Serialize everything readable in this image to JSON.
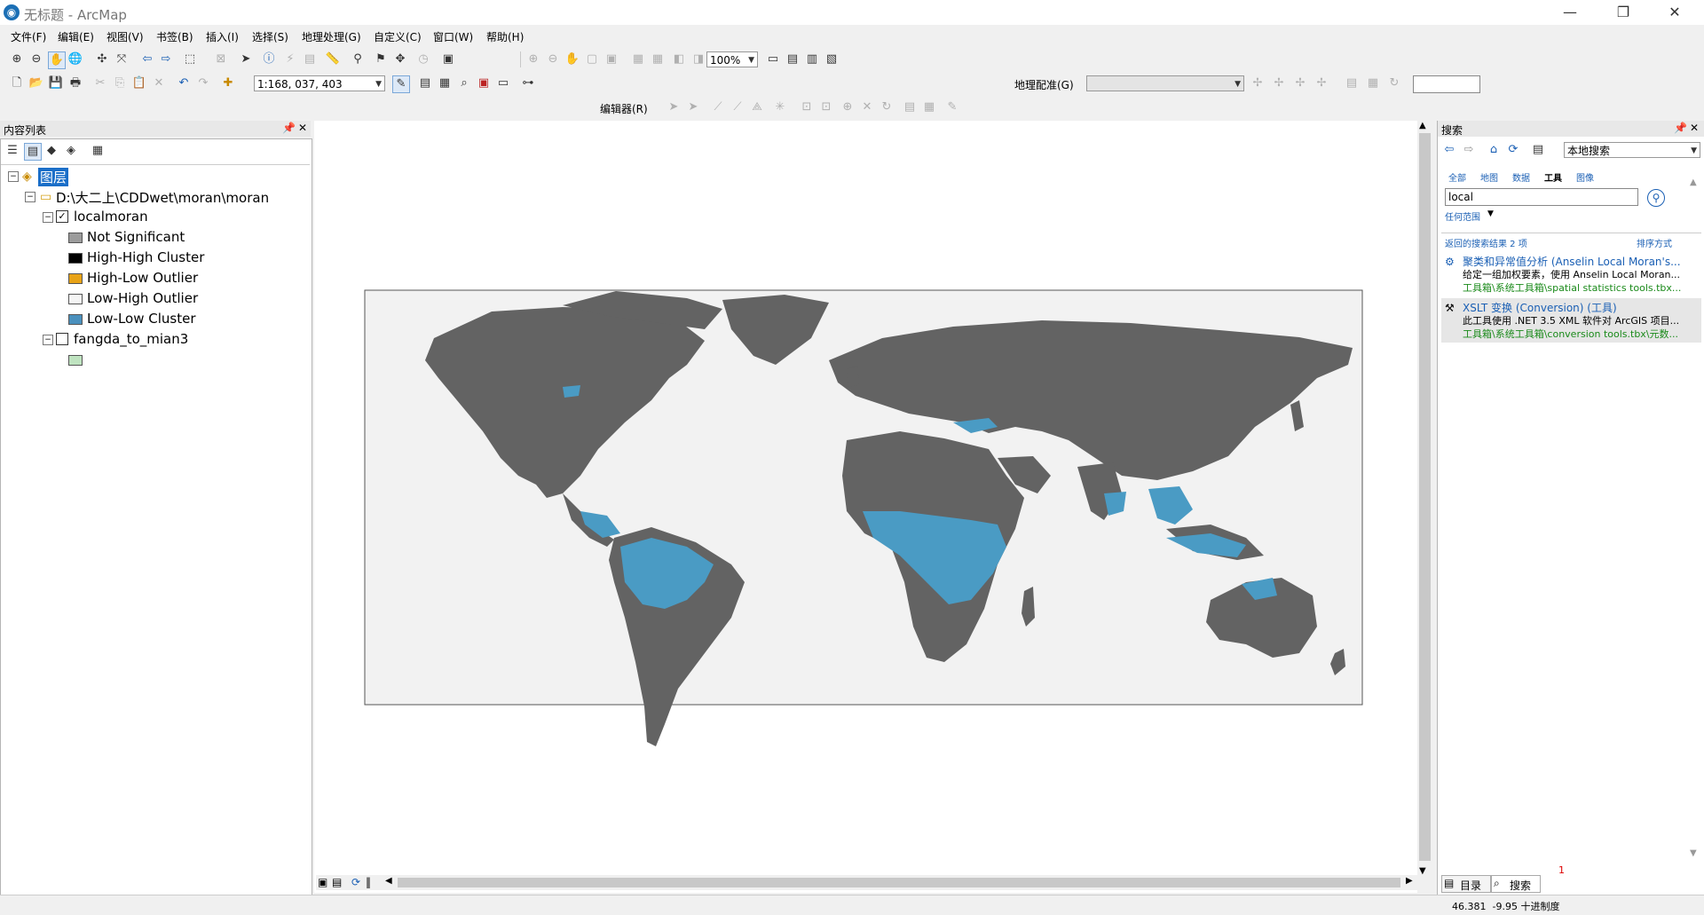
{
  "window": {
    "title": "无标题 - ArcMap",
    "app_icon": "globe-icon",
    "controls": [
      "—",
      "❐",
      "✕"
    ]
  },
  "menu": [
    "文件(F)",
    "编辑(E)",
    "视图(V)",
    "书签(B)",
    "插入(I)",
    "选择(S)",
    "地理处理(G)",
    "自定义(C)",
    "窗口(W)",
    "帮助(H)"
  ],
  "toolbar": {
    "zoom_percent": "100%",
    "scale": "1:168, 037, 403",
    "georef_label": "地理配准(G)",
    "editor_label": "编辑器(R)"
  },
  "toc": {
    "title": "内容列表",
    "root_label": "图层",
    "folder": "D:\\大二上\\CDDwet\\moran\\moran",
    "layer1": "localmoran",
    "legend": [
      {
        "label": "Not Significant",
        "color": "#9b9b9b"
      },
      {
        "label": "High-High Cluster",
        "color": "#000000"
      },
      {
        "label": "High-Low Outlier",
        "color": "#e8a317"
      },
      {
        "label": "Low-High Outlier",
        "color": "#f5f5f5"
      },
      {
        "label": "Low-Low Cluster",
        "color": "#4a90bd"
      }
    ],
    "layer2": "fangda_to_mian3",
    "layer2_color": "#bfe3c0"
  },
  "map": {
    "land_color": "#636363",
    "cluster_color": "#4a9bc4",
    "background": "#f2f2f2"
  },
  "search": {
    "title": "搜索",
    "scope_dropdown": "本地搜索",
    "filters": [
      "全部",
      "地图",
      "数据",
      "工具",
      "图像"
    ],
    "query": "local",
    "extent_label": "任何范围",
    "results_count": "返回的搜索结果 2 项",
    "sort_label": "排序方式",
    "results": [
      {
        "title": "聚类和异常值分析 (Anselin Local Moran's...",
        "desc": "给定一组加权要素，使用 Anselin Local Moran...",
        "path": "工具箱\\系统工具箱\\spatial statistics tools.tbx..."
      },
      {
        "title": "XSLT 变换 (Conversion) (工具)",
        "desc": "此工具使用 .NET 3.5 XML 软件对 ArcGIS 项目...",
        "path": "工具箱\\系统工具箱\\conversion tools.tbx\\元数..."
      }
    ],
    "page_number": "1",
    "tabs": [
      "目录",
      "搜索"
    ]
  },
  "status": {
    "coords": "46.381  -9.95 十进制度"
  }
}
